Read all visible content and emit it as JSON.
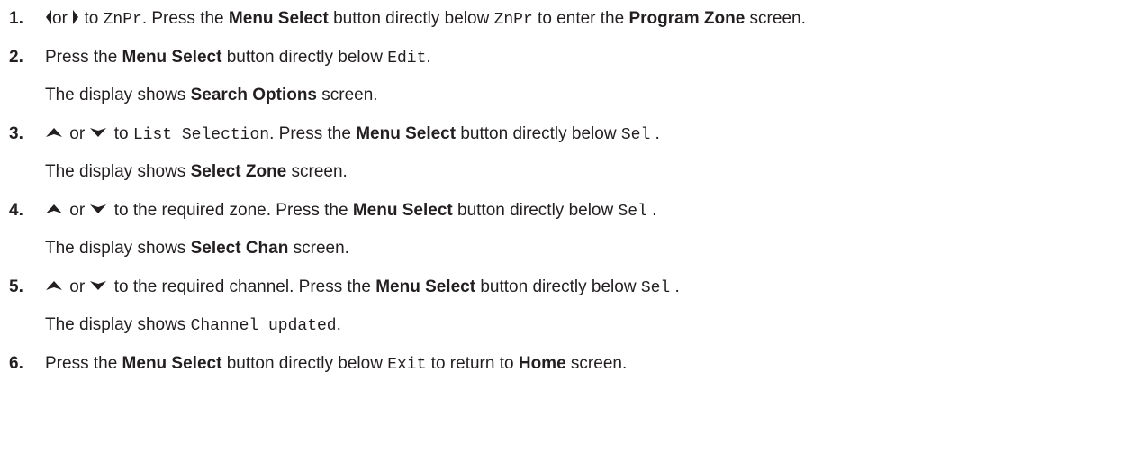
{
  "steps": [
    {
      "number": "1.",
      "lines": [
        {
          "parts": [
            {
              "icon": "left-arrow-icon"
            },
            {
              "text": "or "
            },
            {
              "icon": "right-arrow-icon"
            },
            {
              "text": " to "
            },
            {
              "mono": "ZnPr"
            },
            {
              "text": ". Press the "
            },
            {
              "bold": "Menu Select"
            },
            {
              "text": " button directly below "
            },
            {
              "mono": "ZnPr"
            },
            {
              "text": " to enter the "
            },
            {
              "bold": "Program Zone"
            },
            {
              "text": " screen."
            }
          ]
        }
      ]
    },
    {
      "number": "2.",
      "lines": [
        {
          "parts": [
            {
              "text": "Press the "
            },
            {
              "bold": "Menu Select"
            },
            {
              "text": " button directly below "
            },
            {
              "mono": "Edit"
            },
            {
              "text": "."
            }
          ]
        },
        {
          "parts": [
            {
              "text": "The display shows "
            },
            {
              "bold": "Search Options"
            },
            {
              "text": " screen."
            }
          ]
        }
      ]
    },
    {
      "number": "3.",
      "lines": [
        {
          "parts": [
            {
              "icon": "up-arrow-icon"
            },
            {
              "text": " or "
            },
            {
              "icon": "down-arrow-icon"
            },
            {
              "text": " to "
            },
            {
              "mono": "List Selection"
            },
            {
              "text": ". Press the "
            },
            {
              "bold": "Menu Select"
            },
            {
              "text": " button directly below "
            },
            {
              "mono": "Sel"
            },
            {
              "text": " ."
            }
          ]
        },
        {
          "parts": [
            {
              "text": "The display shows "
            },
            {
              "bold": "Select Zone"
            },
            {
              "text": " screen."
            }
          ]
        }
      ]
    },
    {
      "number": "4.",
      "lines": [
        {
          "parts": [
            {
              "icon": "up-arrow-icon"
            },
            {
              "text": " or "
            },
            {
              "icon": "down-arrow-icon"
            },
            {
              "text": " to the required zone. Press the "
            },
            {
              "bold": "Menu Select"
            },
            {
              "text": " button directly below "
            },
            {
              "mono": "Sel"
            },
            {
              "text": " ."
            }
          ]
        },
        {
          "parts": [
            {
              "text": "The display shows "
            },
            {
              "bold": "Select Chan"
            },
            {
              "text": " screen."
            }
          ]
        }
      ]
    },
    {
      "number": "5.",
      "lines": [
        {
          "parts": [
            {
              "icon": "up-arrow-icon"
            },
            {
              "text": " or "
            },
            {
              "icon": "down-arrow-icon"
            },
            {
              "text": " to the required channel. Press the "
            },
            {
              "bold": "Menu Select"
            },
            {
              "text": " button directly below "
            },
            {
              "mono": "Sel"
            },
            {
              "text": " ."
            }
          ]
        },
        {
          "parts": [
            {
              "text": "The display shows "
            },
            {
              "mono": "Channel updated"
            },
            {
              "text": "."
            }
          ]
        }
      ]
    },
    {
      "number": "6.",
      "lines": [
        {
          "parts": [
            {
              "text": "Press the "
            },
            {
              "bold": "Menu Select"
            },
            {
              "text": " button directly below "
            },
            {
              "mono": "Exit"
            },
            {
              "text": " to return to "
            },
            {
              "bold": "Home"
            },
            {
              "text": " screen."
            }
          ]
        }
      ]
    }
  ],
  "colors": {
    "text": "#231f20",
    "icon": "#231f20",
    "background": "#ffffff"
  }
}
